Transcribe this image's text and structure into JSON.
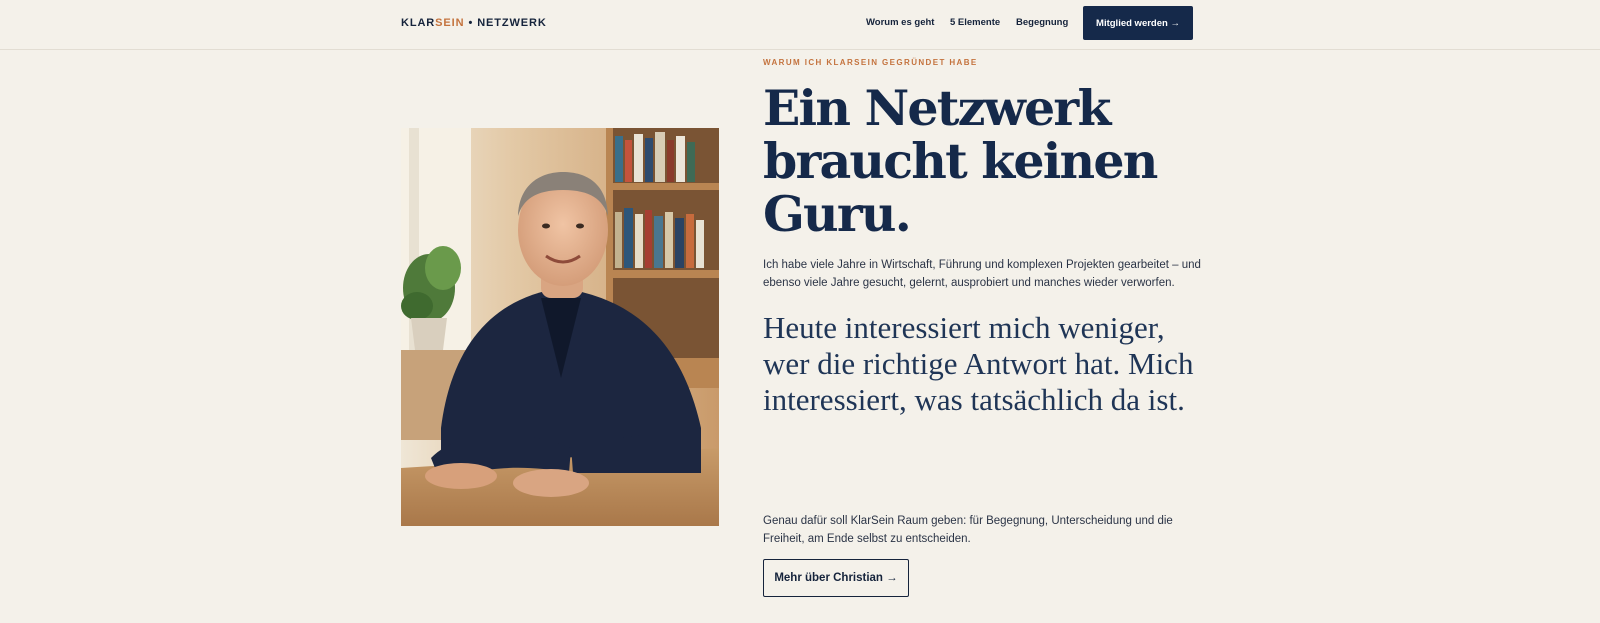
{
  "header": {
    "logo": {
      "part1": "KLAR",
      "part2": "SEIN",
      "separator": "•",
      "part3": "NETZWERK"
    },
    "nav": [
      {
        "label": "Worum es geht"
      },
      {
        "label": "5 Elemente"
      },
      {
        "label": "Begegnung"
      }
    ],
    "cta_label": "Mitglied werden →"
  },
  "hero": {
    "eyebrow": "WARUM ICH KLARSEIN GEGRÜNDET HABE",
    "headline": "Ein Netzwerk braucht keinen Guru.",
    "intro": "Ich habe viele Jahre in Wirtschaft, Führung und komplexen Projekten gearbeitet – und ebenso viele Jahre gesucht, gelernt, ausprobiert und manches wieder verworfen.",
    "quote": "Heute interessiert mich weniger, wer die richtige Antwort hat. Mich interessiert, was tatsächlich da ist.",
    "closing": "Genau dafür soll KlarSein Raum geben: für Begegnung, Unterscheidung und die Freiheit, am Ende selbst zu entscheiden.",
    "cta_label": "Mehr über Christian →"
  },
  "colors": {
    "background": "#f4f1ea",
    "navy": "#15294a",
    "accent": "#c4733e"
  }
}
